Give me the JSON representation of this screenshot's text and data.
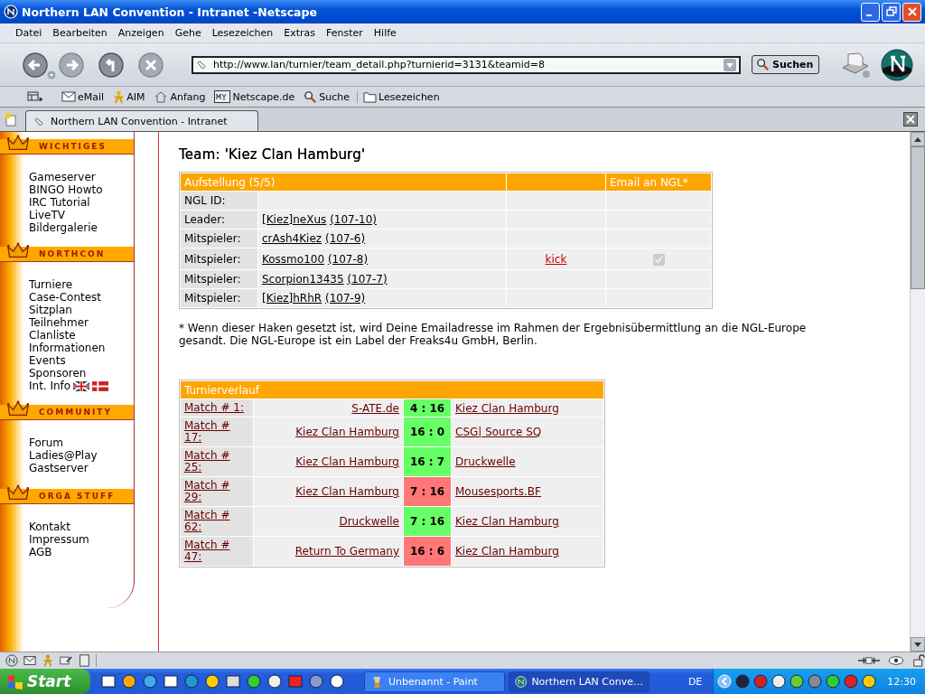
{
  "window": {
    "title": "Northern LAN Convention - Intranet -Netscape"
  },
  "menu": [
    "Datei",
    "Bearbeiten",
    "Anzeigen",
    "Gehe",
    "Lesezeichen",
    "Extras",
    "Fenster",
    "Hilfe"
  ],
  "navigation": {
    "url": "http://www.lan/turnier/team_detail.php?turnierid=3131&teamid=8",
    "search_button": "Suchen"
  },
  "personal_toolbar": [
    {
      "label": "eMail",
      "kind": "mail"
    },
    {
      "label": "AIM",
      "kind": "aim"
    },
    {
      "label": "Anfang",
      "kind": "home"
    },
    {
      "label": "Netscape.de",
      "kind": "my"
    },
    {
      "label": "Suche",
      "kind": "search"
    },
    {
      "label": "Lesezeichen",
      "kind": "folder"
    }
  ],
  "tabs": [
    {
      "label": "Northern LAN Convention - Intranet",
      "selected": true
    }
  ],
  "sidebar": {
    "sections": [
      {
        "title": "WICHTIGES",
        "items": [
          {
            "label": "Gameserver",
            "kind": "link"
          },
          {
            "label": "BINGO Howto",
            "kind": "link"
          },
          {
            "label": "IRC Tutorial",
            "kind": "link"
          },
          {
            "label": "LiveTV",
            "kind": "link"
          },
          {
            "label": "Bildergalerie",
            "kind": "link"
          }
        ]
      },
      {
        "title": "NORTHCON",
        "items": [
          {
            "label": "Turniere",
            "kind": "link"
          },
          {
            "label": "Case-Contest",
            "kind": "link"
          },
          {
            "label": "Sitzplan",
            "kind": "link"
          },
          {
            "label": "Teilnehmer",
            "kind": "link"
          },
          {
            "label": "Clanliste",
            "kind": "link"
          },
          {
            "label": "Informationen",
            "kind": "link"
          },
          {
            "label": "Events",
            "kind": "link"
          },
          {
            "label": "Sponsoren",
            "kind": "link"
          },
          {
            "label": "Int. Info",
            "kind": "flags"
          }
        ]
      },
      {
        "title": "COMMUNITY",
        "items": [
          {
            "label": "Forum",
            "kind": "link"
          },
          {
            "label": "Ladies@Play",
            "kind": "link"
          },
          {
            "label": "Gastserver",
            "kind": "link"
          }
        ]
      },
      {
        "title": "ORGA STUFF",
        "items": [
          {
            "label": "Kontakt",
            "kind": "link"
          },
          {
            "label": "Impressum",
            "kind": "link"
          },
          {
            "label": "AGB",
            "kind": "link"
          }
        ]
      }
    ]
  },
  "page": {
    "title": "Team: 'Kiez Clan Hamburg'",
    "lineup": {
      "header": "Aufstellung (5/5)",
      "email_header": "Email an NGL*",
      "rows": [
        {
          "role": "NGL ID:"
        },
        {
          "role": "Leader:",
          "player": "[Kiez]neXus",
          "player_id": "(107-10)"
        },
        {
          "role": "Mitspieler:",
          "player": "crAsh4Kiez",
          "player_id": "(107-6)"
        },
        {
          "role": "Mitspieler:",
          "player": "Kossmo100",
          "player_id": "(107-8)",
          "action": "kick",
          "email": {
            "checked": true,
            "disabled": true
          }
        },
        {
          "role": "Mitspieler:",
          "player": "Scorpion13435",
          "player_id": "(107-7)"
        },
        {
          "role": "Mitspieler:",
          "player": "[Kiez]hRhR",
          "player_id": "(107-9)"
        }
      ]
    },
    "footnote": "* Wenn dieser Haken gesetzt ist, wird Deine Emailadresse im Rahmen der Ergebnisübermittlung an die NGL-Europe gesandt. Die NGL-Europe ist ein Label der Freaks4u GmbH, Berlin.",
    "matches": {
      "title": "Turnierverlauf",
      "rows": [
        {
          "match": "Match # 1:",
          "team1": "S-ATE.de",
          "score": "4 : 16",
          "color": "#66ff66",
          "team2": "Kiez Clan Hamburg"
        },
        {
          "match": "Match # 17:",
          "team1": "Kiez Clan Hamburg",
          "score": "16 : 0",
          "color": "#66ff66",
          "team2": "CSG| Source SQ"
        },
        {
          "match": "Match # 25:",
          "team1": "Kiez Clan Hamburg",
          "score": "16 : 7",
          "color": "#66ff66",
          "team2": "Druckwelle"
        },
        {
          "match": "Match # 29:",
          "team1": "Kiez Clan Hamburg",
          "score": "7 : 16",
          "color": "#ff7777",
          "team2": "Mousesports.BF"
        },
        {
          "match": "Match # 62:",
          "team1": "Druckwelle",
          "score": "7 : 16",
          "color": "#66ff66",
          "team2": "Kiez Clan Hamburg"
        },
        {
          "match": "Match # 47:",
          "team1": "Return To Germany",
          "score": "16 : 6",
          "color": "#ff7777",
          "team2": "Kiez Clan Hamburg"
        }
      ]
    }
  },
  "taskbar": {
    "start": "Start",
    "tasks": [
      {
        "label": "Unbenannt - Paint",
        "selected": false
      },
      {
        "label": "Northern LAN Conve…",
        "selected": true
      }
    ],
    "language": "DE",
    "clock": "12:30"
  }
}
